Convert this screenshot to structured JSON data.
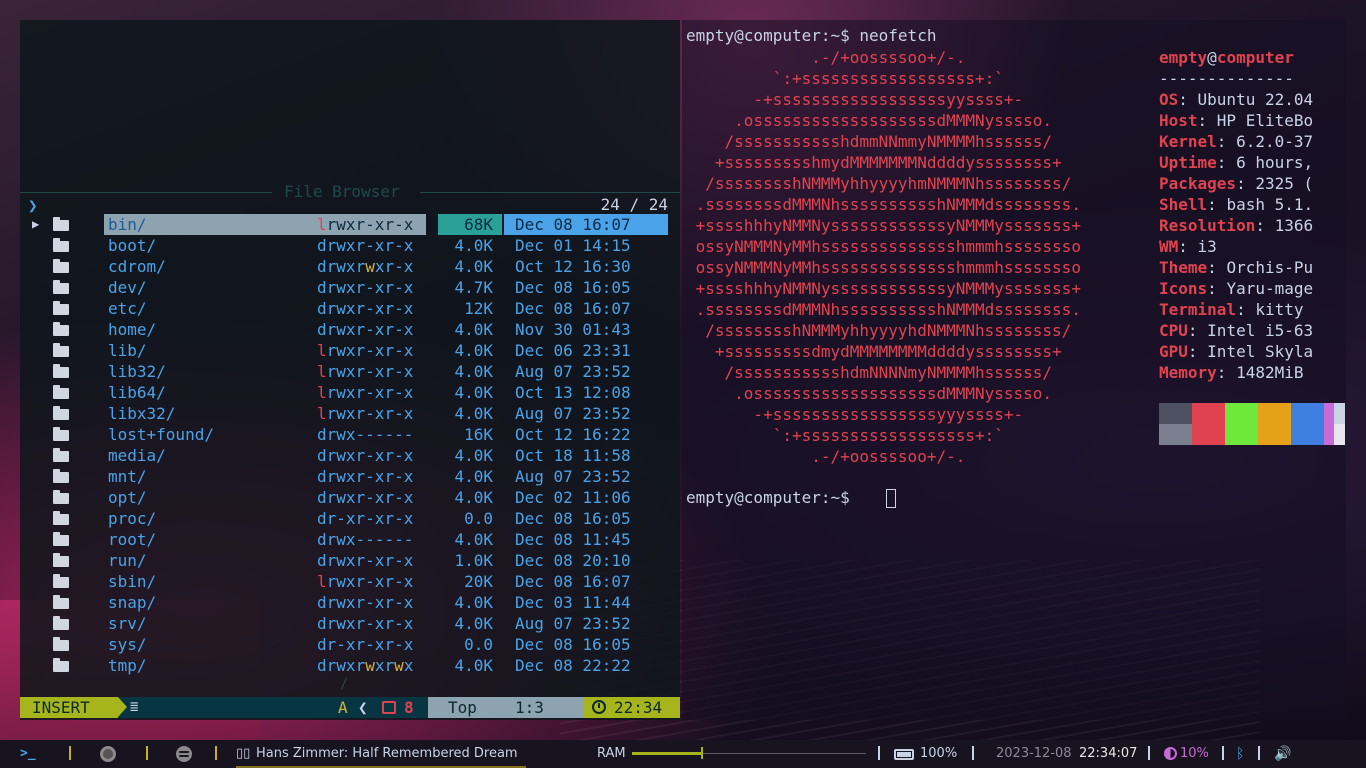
{
  "file_browser": {
    "title": "File Browser",
    "prompt_glyph": "❯",
    "count": "24 / 24",
    "rows": [
      {
        "name": "bin/",
        "perm_l": "l",
        "perm_rest": "rwxr-xr-x",
        "size": "68K",
        "date": "Dec 08 16:07",
        "selected": true
      },
      {
        "name": "boot/",
        "perm_l": "d",
        "perm_rest": "rwxr-xr-x",
        "size": "4.0K",
        "date": "Dec 01 14:15"
      },
      {
        "name": "cdrom/",
        "perm_l": "d",
        "perm_rest": "rwxrwxr-x",
        "size": "4.0K",
        "date": "Oct 12 16:30"
      },
      {
        "name": "dev/",
        "perm_l": "d",
        "perm_rest": "rwxr-xr-x",
        "size": "4.7K",
        "date": "Dec 08 16:05"
      },
      {
        "name": "etc/",
        "perm_l": "d",
        "perm_rest": "rwxr-xr-x",
        "size": "12K",
        "date": "Dec 08 16:07"
      },
      {
        "name": "home/",
        "perm_l": "d",
        "perm_rest": "rwxr-xr-x",
        "size": "4.0K",
        "date": "Nov 30 01:43"
      },
      {
        "name": "lib/",
        "perm_l": "l",
        "perm_rest": "rwxr-xr-x",
        "size": "4.0K",
        "date": "Dec 06 23:31"
      },
      {
        "name": "lib32/",
        "perm_l": "l",
        "perm_rest": "rwxr-xr-x",
        "size": "4.0K",
        "date": "Aug 07 23:52"
      },
      {
        "name": "lib64/",
        "perm_l": "l",
        "perm_rest": "rwxr-xr-x",
        "size": "4.0K",
        "date": "Oct 13 12:08"
      },
      {
        "name": "libx32/",
        "perm_l": "l",
        "perm_rest": "rwxr-xr-x",
        "size": "4.0K",
        "date": "Aug 07 23:52"
      },
      {
        "name": "lost+found/",
        "perm_l": "d",
        "perm_rest": "rwx------",
        "size": "16K",
        "date": "Oct 12 16:22"
      },
      {
        "name": "media/",
        "perm_l": "d",
        "perm_rest": "rwxr-xr-x",
        "size": "4.0K",
        "date": "Oct 18 11:58"
      },
      {
        "name": "mnt/",
        "perm_l": "d",
        "perm_rest": "rwxr-xr-x",
        "size": "4.0K",
        "date": "Aug 07 23:52"
      },
      {
        "name": "opt/",
        "perm_l": "d",
        "perm_rest": "rwxr-xr-x",
        "size": "4.0K",
        "date": "Dec 02 11:06"
      },
      {
        "name": "proc/",
        "perm_l": "d",
        "perm_rest": "r-xr-xr-x",
        "size": "0.0",
        "date": "Dec 08 16:05"
      },
      {
        "name": "root/",
        "perm_l": "d",
        "perm_rest": "rwx------",
        "size": "4.0K",
        "date": "Dec 08 11:45"
      },
      {
        "name": "run/",
        "perm_l": "d",
        "perm_rest": "rwxr-xr-x",
        "size": "1.0K",
        "date": "Dec 08 20:10"
      },
      {
        "name": "sbin/",
        "perm_l": "l",
        "perm_rest": "rwxr-xr-x",
        "size": "20K",
        "date": "Dec 08 16:07"
      },
      {
        "name": "snap/",
        "perm_l": "d",
        "perm_rest": "rwxr-xr-x",
        "size": "4.0K",
        "date": "Dec 03 11:44"
      },
      {
        "name": "srv/",
        "perm_l": "d",
        "perm_rest": "rwxr-xr-x",
        "size": "4.0K",
        "date": "Aug 07 23:52"
      },
      {
        "name": "sys/",
        "perm_l": "d",
        "perm_rest": "r-xr-xr-x",
        "size": "0.0",
        "date": "Dec 08 16:05"
      },
      {
        "name": "tmp/",
        "perm_l": "d",
        "perm_rest": "rwxrwxrwx",
        "size": "4.0K",
        "date": "Dec 08 22:22"
      }
    ],
    "slash": "/"
  },
  "statusline": {
    "mode": "INSERT",
    "a_label": "A",
    "chevron": "❮",
    "errors": "8",
    "top": "Top",
    "position": "1:3",
    "time": "22:34"
  },
  "terminal": {
    "prompt": "empty@computer:~$ ",
    "command": "neofetch",
    "prompt2": "empty@computer:~$ ",
    "logo": [
      "             .-/+oossssoo+/-.",
      "         `:+ssssssssssssssssss+:`",
      "       -+ssssssssssssssssssyyssss+-",
      "     .osssssssssssssssssssdMMMNysssso.",
      "    /ssssssssssshdmmNNmmyNMMMMhssssss/",
      "   +ssssssssshmydMMMMMMMNddddyssssssss+",
      "  /sssssssshNMMMyhhyyyyhmNMMMNhssssssss/",
      " .ssssssssdMMMNhsssssssssshNMMMdssssssss.",
      " +sssshhhyNMMNyssssssssssssyNMMMysssssss+",
      " ossyNMMMNyMMhsssssssssssssshmmmhssssssso",
      " ossyNMMMNyMMhsssssssssssssshmmmhssssssso",
      " +sssshhhyNMMNyssssssssssssyNMMMysssssss+",
      " .ssssssssdMMMNhsssssssssshNMMMdssssssss.",
      "  /sssssssshNMMMyhhyyyyhdNMMMNhssssssss/",
      "   +sssssssssdmydMMMMMMMMddddyssssssss+",
      "    /ssssssssssshdmNNNNmyNMMMMhssssss/",
      "     .osssssssssssssssssssdMMMNysssso.",
      "       -+sssssssssssssssssyyyssss+-",
      "         `:+ssssssssssssssssss+:`",
      "             .-/+oossssoo+/-."
    ],
    "info": {
      "user": "empty",
      "at": "@",
      "host": "computer",
      "separator": "--------------",
      "lines": [
        {
          "key": "OS",
          "value": ": Ubuntu 22.04"
        },
        {
          "key": "Host",
          "value": ": HP EliteBo"
        },
        {
          "key": "Kernel",
          "value": ": 6.2.0-37"
        },
        {
          "key": "Uptime",
          "value": ": 6 hours,"
        },
        {
          "key": "Packages",
          "value": ": 2325 ("
        },
        {
          "key": "Shell",
          "value": ": bash 5.1."
        },
        {
          "key": "Resolution",
          "value": ": 1366"
        },
        {
          "key": "WM",
          "value": ": i3"
        },
        {
          "key": "Theme",
          "value": ": Orchis-Pu"
        },
        {
          "key": "Icons",
          "value": ": Yaru-mage"
        },
        {
          "key": "Terminal",
          "value": ": kitty"
        },
        {
          "key": "CPU",
          "value": ": Intel i5-63"
        },
        {
          "key": "GPU",
          "value": ": Intel Skyla"
        },
        {
          "key": "Memory",
          "value": ": 1482MiB"
        }
      ]
    },
    "palette_top": [
      "#4c5060",
      "#e0434f",
      "#6ee83a",
      "#e3a21a",
      "#3f7fe0",
      "#c86ad8",
      "#c8d3e6"
    ],
    "palette_bottom": [
      "#7a8090",
      "#e0434f",
      "#6ee83a",
      "#e3a21a",
      "#3f7fe0",
      "#c86ad8",
      "#e6e6f0"
    ]
  },
  "bar": {
    "terminal_icon": ">_",
    "music_icon": "▯▯",
    "song": "Hans Zimmer: Half Remembered Dream",
    "ram_label": "RAM",
    "ram_fraction": 0.3,
    "battery": "100%",
    "date": "2023-12-08",
    "time": "22:34:07",
    "brightness": "10%",
    "bluetooth_icon": "ᛒ",
    "volume_icon": "🔊"
  },
  "colors": {
    "accent_blue": "#4aa3e8",
    "accent_red": "#e0434f",
    "accent_green": "#a6b51c",
    "text": "#c8d3e6"
  }
}
